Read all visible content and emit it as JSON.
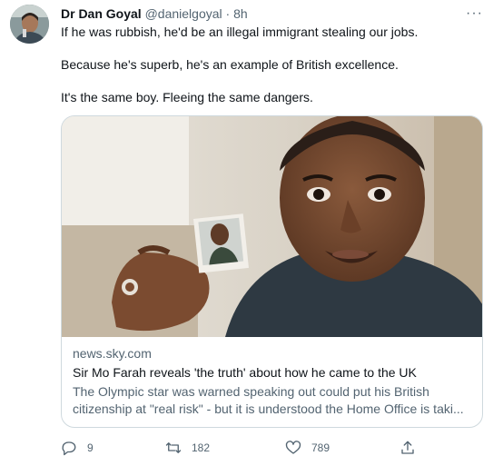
{
  "author": {
    "name": "Dr Dan Goyal",
    "handle": "@danielgoyal",
    "separator": "·",
    "time": "8h",
    "avatar_icon": "profile-photo"
  },
  "tweet": {
    "lines": [
      "If he was rubbish, he'd be an illegal immigrant stealing our jobs.",
      "Because he's superb, he's an example of British excellence.",
      "It's the same boy. Fleeing the same dangers."
    ]
  },
  "card": {
    "domain": "news.sky.com",
    "title": "Sir Mo Farah reveals 'the truth' about how he came to the UK",
    "description_line1": "The Olympic star was warned speaking out could put his British",
    "description_line2": "citizenship at \"real risk\" - but it is understood the Home Office is taki..."
  },
  "actions": {
    "replies": "9",
    "retweets": "182",
    "likes": "789"
  },
  "colors": {
    "text": "#0f1419",
    "secondary": "#536471",
    "border": "#cfd9de"
  }
}
